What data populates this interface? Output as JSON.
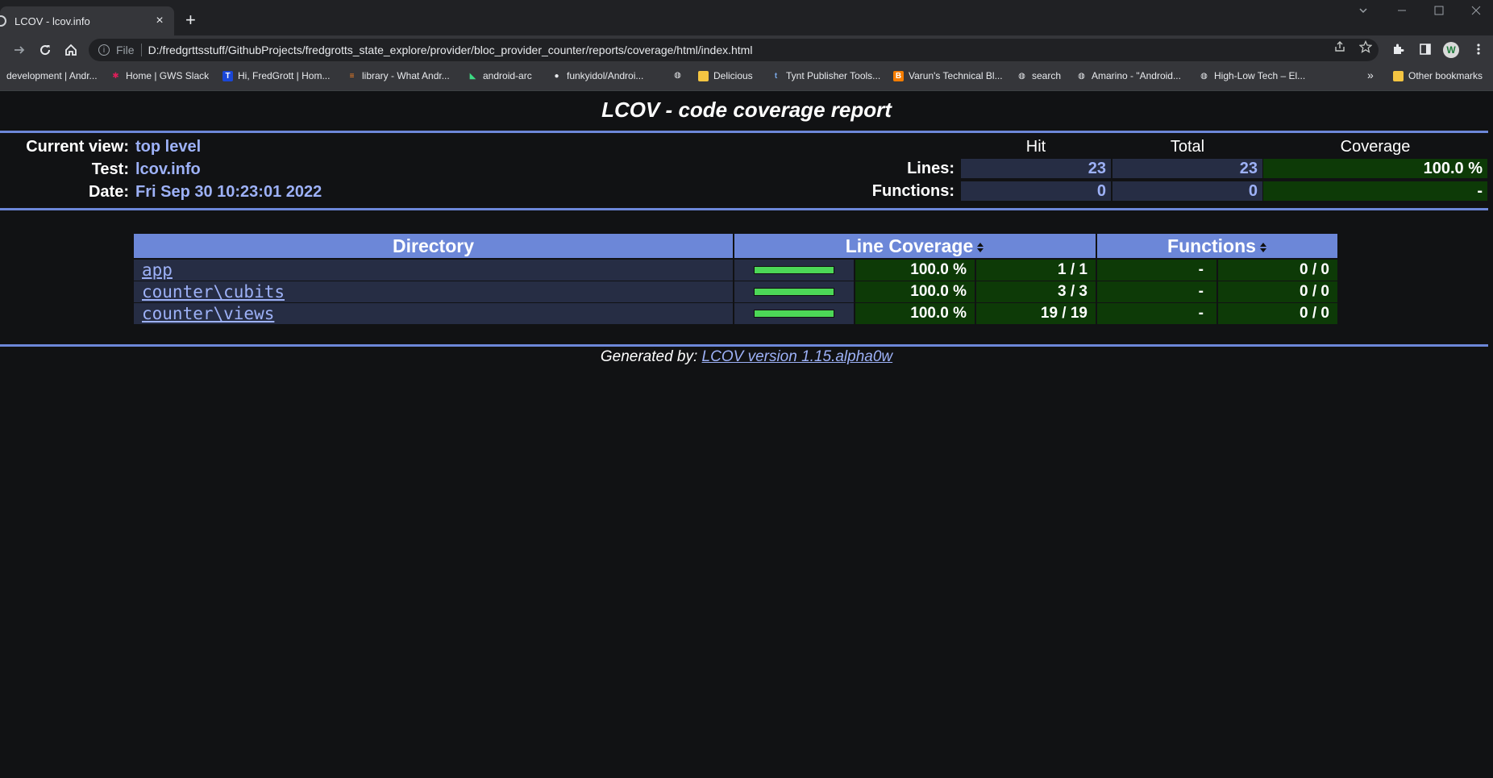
{
  "browser": {
    "tab_title": "LCOV - lcov.info",
    "close_glyph": "×",
    "new_tab_glyph": "+",
    "address_scheme": "File",
    "address_url": "D:/fredgrttsstuff/GithubProjects/fredgrotts_state_explore/provider/bloc_provider_counter/reports/coverage/html/index.html",
    "avatar_letter": "W",
    "bookmarks": [
      {
        "label": "development | Andr...",
        "icon": "none"
      },
      {
        "label": "Home | GWS Slack",
        "icon": "slack-icon"
      },
      {
        "label": "Hi, FredGrott | Hom...",
        "icon": "T"
      },
      {
        "label": "library - What Andr...",
        "icon": "library-icon"
      },
      {
        "label": "android-arc",
        "icon": "android-icon"
      },
      {
        "label": "funkyidol/Androi...",
        "icon": "github-icon"
      },
      {
        "label": "",
        "icon": "globe-icon"
      },
      {
        "label": "Delicious",
        "icon": "folder-icon"
      },
      {
        "label": "Tynt Publisher Tools...",
        "icon": "tynt-icon"
      },
      {
        "label": "Varun's Technical Bl...",
        "icon": "blogger-icon"
      },
      {
        "label": "search",
        "icon": "globe-icon"
      },
      {
        "label": "Amarino - \"Android...",
        "icon": "globe-icon"
      },
      {
        "label": "High-Low Tech – El...",
        "icon": "globe-icon"
      }
    ],
    "more_glyph": "»",
    "other_bookmarks": "Other bookmarks"
  },
  "report": {
    "title": "LCOV - code coverage report",
    "current_view_label": "Current view:",
    "current_view_value": "top level",
    "test_label": "Test:",
    "test_value": "lcov.info",
    "date_label": "Date:",
    "date_value": "Fri Sep 30 10:23:01 2022",
    "col_hit": "Hit",
    "col_total": "Total",
    "col_coverage": "Coverage",
    "lines_label": "Lines:",
    "lines_hit": "23",
    "lines_total": "23",
    "lines_coverage": "100.0 %",
    "functions_label": "Functions:",
    "functions_hit": "0",
    "functions_total": "0",
    "functions_coverage": "-"
  },
  "table": {
    "headers": {
      "directory": "Directory",
      "line_coverage": "Line Coverage",
      "functions": "Functions"
    },
    "rows": [
      {
        "name": "app",
        "line_pct": "100.0 %",
        "line_ratio": "1 / 1",
        "line_fraction": 1.0,
        "func_pct": "-",
        "func_ratio": "0 / 0"
      },
      {
        "name": "counter\\cubits",
        "line_pct": "100.0 %",
        "line_ratio": "3 / 3",
        "line_fraction": 1.0,
        "func_pct": "-",
        "func_ratio": "0 / 0"
      },
      {
        "name": "counter\\views",
        "line_pct": "100.0 %",
        "line_ratio": "19 / 19",
        "line_fraction": 1.0,
        "func_pct": "-",
        "func_ratio": "0 / 0"
      }
    ]
  },
  "footer": {
    "prefix": "Generated by:",
    "link": "LCOV version 1.15.alpha0w"
  },
  "colors": {
    "page_bg": "#111214",
    "header_blue": "#6c87d8",
    "value_blue": "#9db1f7",
    "coverage_green": "#0d3a07",
    "bar_green": "#4cd857"
  }
}
